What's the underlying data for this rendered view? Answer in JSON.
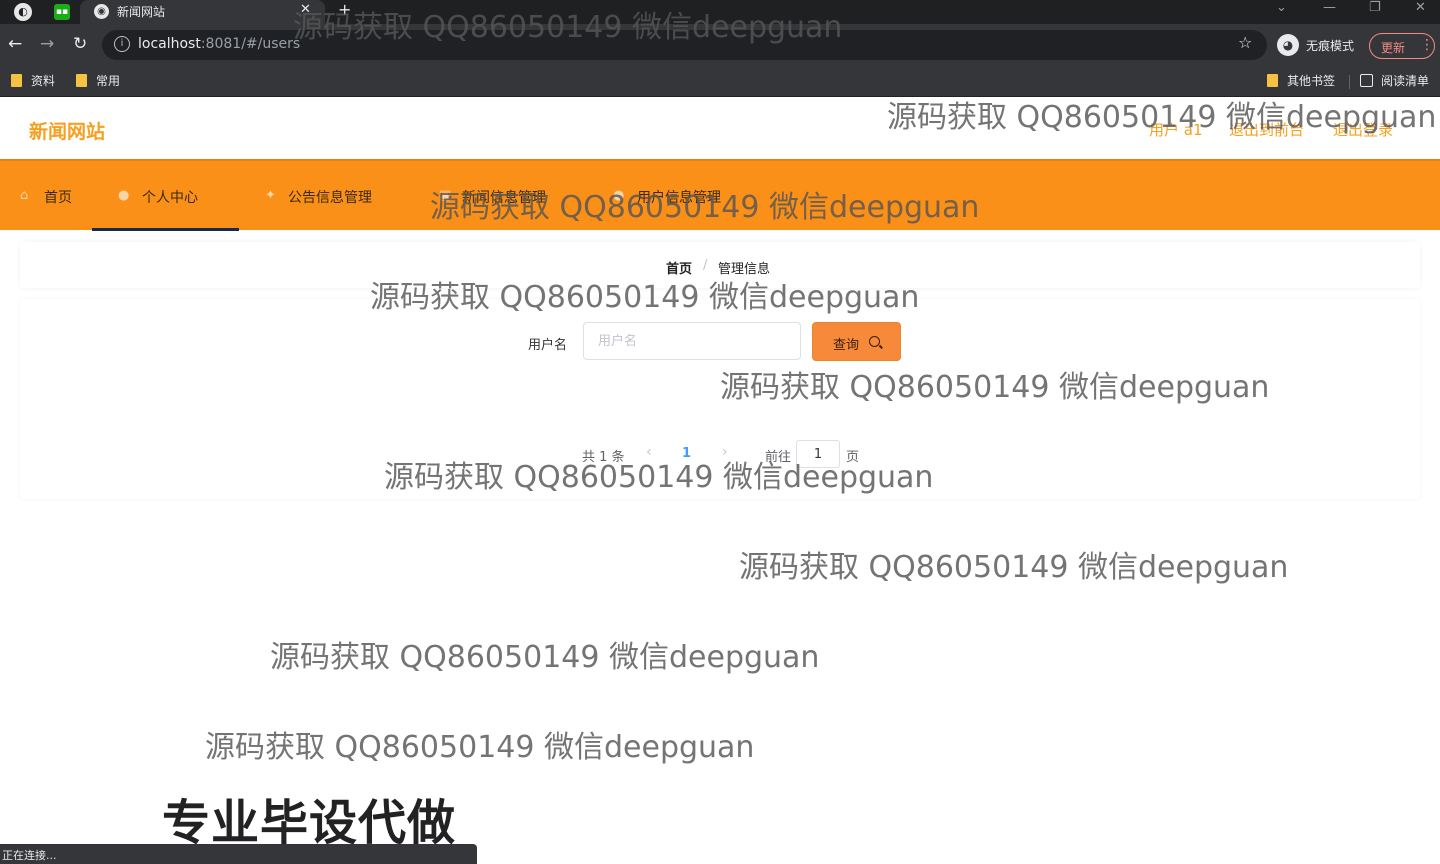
{
  "browser": {
    "tab_title": "新闻网站",
    "url_host": "localhost",
    "url_rest": ":8081/#/users",
    "incognito_label": "无痕模式",
    "update_label": "更新",
    "bookmarks": [
      "资料",
      "常用"
    ],
    "other_bookmarks": "其他书签",
    "reading_list": "阅读清单",
    "status_text": "正在连接..."
  },
  "site": {
    "logo": "新闻网站",
    "user_label": "用户 a1",
    "to_frontend": "退出到前台",
    "logout": "退出登录"
  },
  "nav": {
    "items": [
      {
        "label": "首页",
        "icon": "home-icon"
      },
      {
        "label": "个人中心",
        "icon": "user-icon"
      },
      {
        "label": "公告信息管理",
        "icon": "pin-icon"
      },
      {
        "label": "新闻信息管理",
        "icon": "news-icon"
      },
      {
        "label": "用户信息管理",
        "icon": "people-icon"
      }
    ],
    "active": "个人中心"
  },
  "breadcrumb": {
    "home": "首页",
    "sep": "/",
    "current": "管理信息"
  },
  "search": {
    "label": "用户名",
    "placeholder": "用户名",
    "value": "",
    "button_label": "查询"
  },
  "pagination": {
    "total_text": "共 1 条",
    "current_page": "1",
    "goto_label": "前往",
    "goto_value": "1",
    "page_suffix": "页"
  },
  "overlay": {
    "watermark": "源码获取 QQ86050149 微信deepguan",
    "banner": "专业毕设代做"
  },
  "colors": {
    "brand_orange": "#fb9018",
    "logo_orange": "#f5a020",
    "button_orange": "#f6893a"
  }
}
